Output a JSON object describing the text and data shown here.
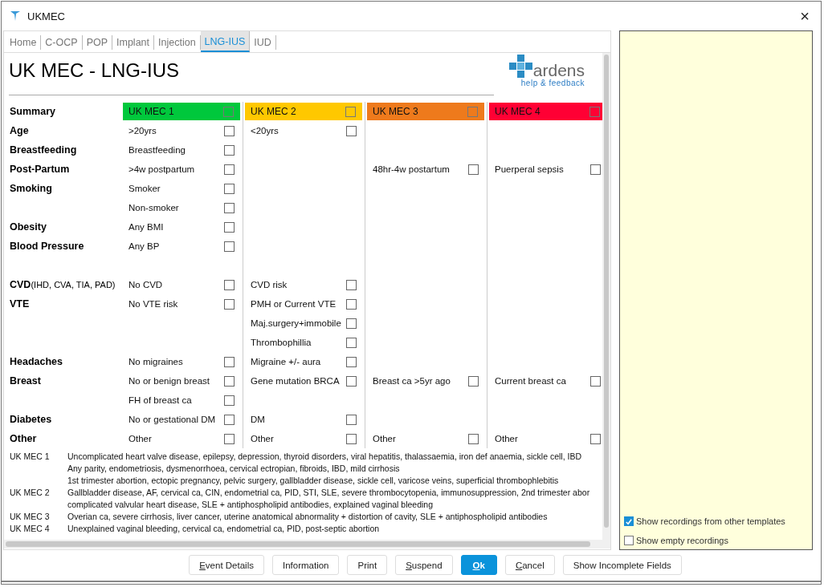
{
  "window": {
    "title": "UKMEC",
    "close": "×"
  },
  "tabs": [
    {
      "label": "Home",
      "selected": false
    },
    {
      "label": "C-OCP",
      "selected": false
    },
    {
      "label": "POP",
      "selected": false
    },
    {
      "label": "Implant",
      "selected": false
    },
    {
      "label": "Injection",
      "selected": false
    },
    {
      "label": "LNG-IUS",
      "selected": true
    },
    {
      "label": "IUD",
      "selected": false
    }
  ],
  "heading": "UK MEC - LNG-IUS",
  "logo": {
    "name": "ardens",
    "link": "help & feedback"
  },
  "summary": {
    "label": "Summary",
    "levels": [
      {
        "label": "UK MEC 1",
        "color": "#00c83c",
        "checked": false
      },
      {
        "label": "UK MEC 2",
        "color": "#ffc800",
        "checked": false
      },
      {
        "label": "UK MEC 3",
        "color": "#ee7a1c",
        "checked": false
      },
      {
        "label": "UK MEC 4",
        "color": "#ff0034",
        "checked": false
      }
    ]
  },
  "rows": [
    {
      "label": "Age",
      "cells": [
        {
          "text": ">20yrs",
          "checked": false
        },
        {
          "text": "<20yrs",
          "checked": false
        },
        null,
        null
      ]
    },
    {
      "label": "Breastfeeding",
      "cells": [
        {
          "text": "Breastfeeding",
          "checked": false
        },
        null,
        null,
        null
      ]
    },
    {
      "label": "Post-Partum",
      "cells": [
        {
          "text": ">4w postpartum",
          "checked": false
        },
        null,
        {
          "text": "48hr-4w postartum",
          "checked": false
        },
        {
          "text": "Puerperal sepsis",
          "checked": false
        }
      ]
    },
    {
      "label": "Smoking",
      "cells": [
        {
          "text": "Smoker",
          "checked": false
        },
        null,
        null,
        null
      ]
    },
    {
      "cells": [
        {
          "text": "Non-smoker",
          "checked": false
        },
        null,
        null,
        null
      ]
    },
    {
      "label": "Obesity",
      "cells": [
        {
          "text": "Any BMI",
          "checked": false
        },
        null,
        null,
        null
      ]
    },
    {
      "label": "Blood Pressure",
      "cells": [
        {
          "text": "Any BP",
          "checked": false
        },
        null,
        null,
        null
      ]
    },
    {
      "cells": [
        null,
        null,
        null,
        null
      ]
    },
    {
      "label": "CVD",
      "note": "(IHD, CVA, TIA, PAD)",
      "cells": [
        {
          "text": "No CVD",
          "checked": false
        },
        {
          "text": "CVD risk",
          "checked": false
        },
        null,
        null
      ]
    },
    {
      "label": "VTE",
      "cells": [
        {
          "text": "No VTE risk",
          "checked": false
        },
        {
          "text": "PMH or Current VTE",
          "checked": false
        },
        null,
        null
      ]
    },
    {
      "cells": [
        null,
        {
          "text": "Maj.surgery+immobile",
          "checked": false
        },
        null,
        null
      ]
    },
    {
      "cells": [
        null,
        {
          "text": "Thrombophillia",
          "checked": false
        },
        null,
        null
      ]
    },
    {
      "label": "Headaches",
      "cells": [
        {
          "text": "No migraines",
          "checked": false
        },
        {
          "text": "Migraine +/- aura",
          "checked": false
        },
        null,
        null
      ]
    },
    {
      "label": "Breast",
      "cells": [
        {
          "text": "No or benign breast",
          "checked": false
        },
        {
          "text": "Gene mutation BRCA",
          "checked": false
        },
        {
          "text": "Breast ca >5yr ago",
          "checked": false
        },
        {
          "text": "Current breast ca",
          "checked": false
        }
      ]
    },
    {
      "cells": [
        {
          "text": "FH of breast ca",
          "checked": false
        },
        null,
        null,
        null
      ]
    },
    {
      "label": "Diabetes",
      "cells": [
        {
          "text": "No or gestational DM",
          "checked": false
        },
        {
          "text": "DM",
          "checked": false
        },
        null,
        null
      ]
    },
    {
      "label": "Other",
      "cells": [
        {
          "text": "Other",
          "checked": false
        },
        {
          "text": "Other",
          "checked": false
        },
        {
          "text": "Other",
          "checked": false
        },
        {
          "text": "Other",
          "checked": false
        }
      ]
    }
  ],
  "legend": [
    {
      "label": "UK MEC 1",
      "lines": [
        "Uncomplicated heart valve disease, epilepsy, depression, thyroid disorders, viral hepatitis, thalassaemia, iron def anaemia, sickle cell, IBD",
        "Any parity, endometriosis,  dysmenorrhoea, cervical ectropian, fibroids, IBD, mild cirrhosis",
        "1st trimester abortion, ectopic pregnancy, pelvic surgery, gallbladder disease, sickle cell, varicose veins, superficial thrombophlebitis"
      ]
    },
    {
      "label": "UK MEC 2",
      "lines": [
        "Gallbladder disease, AF, cervical ca, CIN, endometrial ca, PID, STI,  SLE, severe thrombocytopenia, immunosuppression, 2nd trimester abor",
        "complicated valvular heart disease,  SLE + antiphospholipid antibodies, explained vaginal bleeding"
      ]
    },
    {
      "label": "UK MEC 3",
      "lines": [
        "Overian ca, severe cirrhosis, liver cancer, uterine anatomical abnormality + distortion of cavity,  SLE + antiphospholipid antibodies"
      ]
    },
    {
      "label": "UK MEC 4",
      "lines": [
        "Unexplained vaginal bleeding, cervical ca, endometrial ca, PID, post-septic abortion"
      ]
    }
  ],
  "options": [
    {
      "label": "Show recordings from other templates",
      "checked": true
    },
    {
      "label": "Show empty recordings",
      "checked": false
    }
  ],
  "buttons": [
    {
      "label": "Event Details",
      "underline_first": true,
      "primary": false
    },
    {
      "label": "Information",
      "underline_first": false,
      "primary": false
    },
    {
      "label": "Print",
      "underline_first": false,
      "primary": false
    },
    {
      "label": "Suspend",
      "underline_first": true,
      "primary": false
    },
    {
      "label": "Ok",
      "underline_first": true,
      "primary": true
    },
    {
      "label": "Cancel",
      "underline_first": true,
      "primary": false
    },
    {
      "label": "Show Incomplete Fields",
      "underline_first": false,
      "primary": false
    }
  ]
}
